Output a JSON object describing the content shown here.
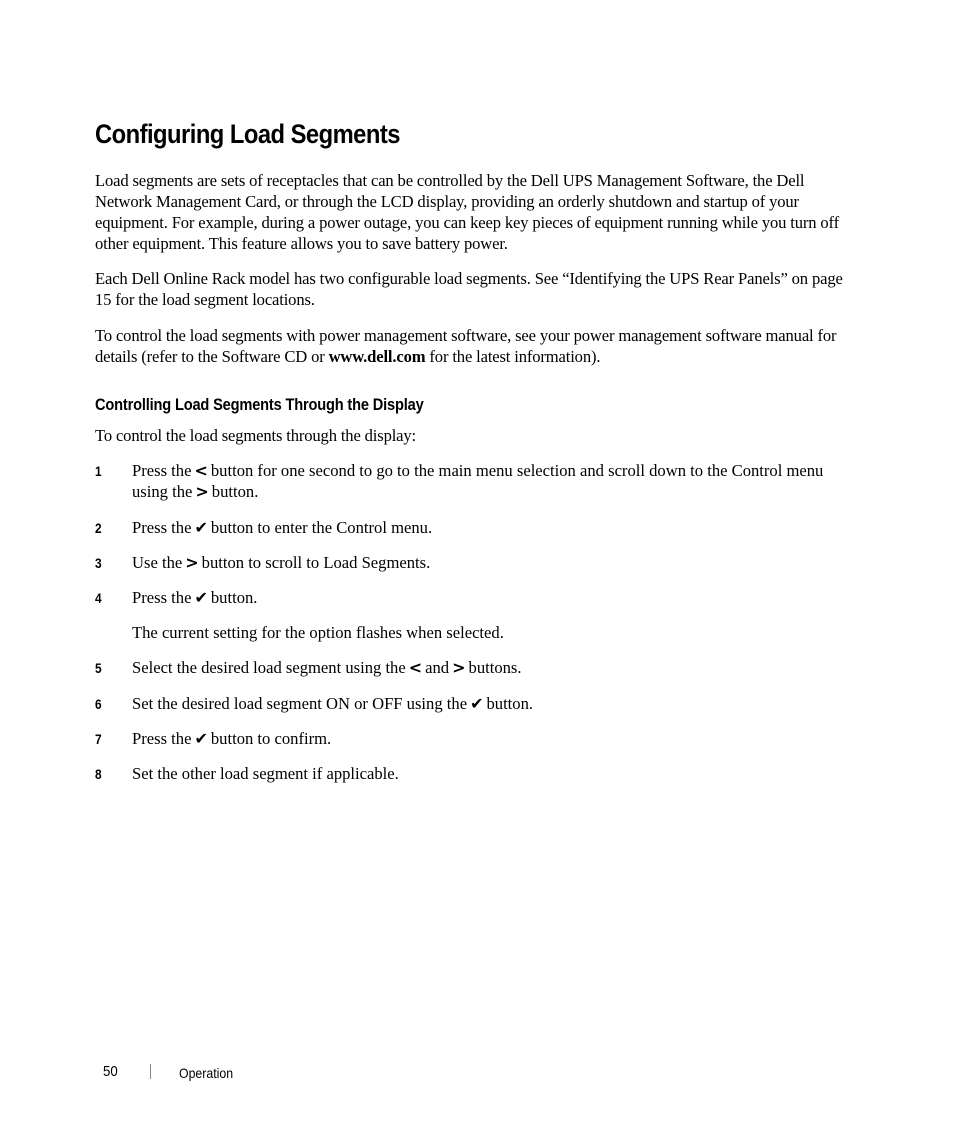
{
  "heading": "Configuring Load Segments",
  "paragraphs": {
    "p1": "Load segments are sets of receptacles that can be controlled by the Dell UPS Management Software, the Dell Network Management Card, or through the LCD display, providing an orderly shutdown and startup of your equipment. For example, during a power outage, you can keep key pieces of equipment running while you turn off other equipment. This feature allows you to save battery power.",
    "p2": "Each Dell Online Rack model has two configurable load segments. See “Identifying the UPS Rear Panels” on page 15 for the load segment locations.",
    "p3_before": "To control the load segments with power management software, see your power management software manual for details (refer to the Software CD or ",
    "p3_link": "www.dell.com",
    "p3_after": " for the latest information)."
  },
  "subheading": "Controlling Load Segments Through the Display",
  "intro": "To control the load segments through the display:",
  "icons": {
    "left": "<",
    "right": ">",
    "check": "✔"
  },
  "steps": [
    {
      "num": "1",
      "a": "Press the",
      "b": "button for one second to go to the main menu selection and scroll down to the Control menu using the",
      "c": "button."
    },
    {
      "num": "2",
      "a": "Press the",
      "b": "button to enter the Control menu."
    },
    {
      "num": "3",
      "a": "Use the",
      "b": "button to scroll to Load Segments."
    },
    {
      "num": "4",
      "a": "Press the",
      "b": "button."
    },
    {
      "num": "5",
      "a": "Select the desired load segment using the",
      "b": "and",
      "c": "buttons."
    },
    {
      "num": "6",
      "a": "Set the desired load segment ON or OFF using the",
      "b": "button."
    },
    {
      "num": "7",
      "a": "Press the",
      "b": "button to confirm."
    },
    {
      "num": "8",
      "a": "Set the other load segment if applicable."
    }
  ],
  "step4_note": "The current setting for the option flashes when selected.",
  "footer": {
    "page_number": "50",
    "section": "Operation"
  }
}
